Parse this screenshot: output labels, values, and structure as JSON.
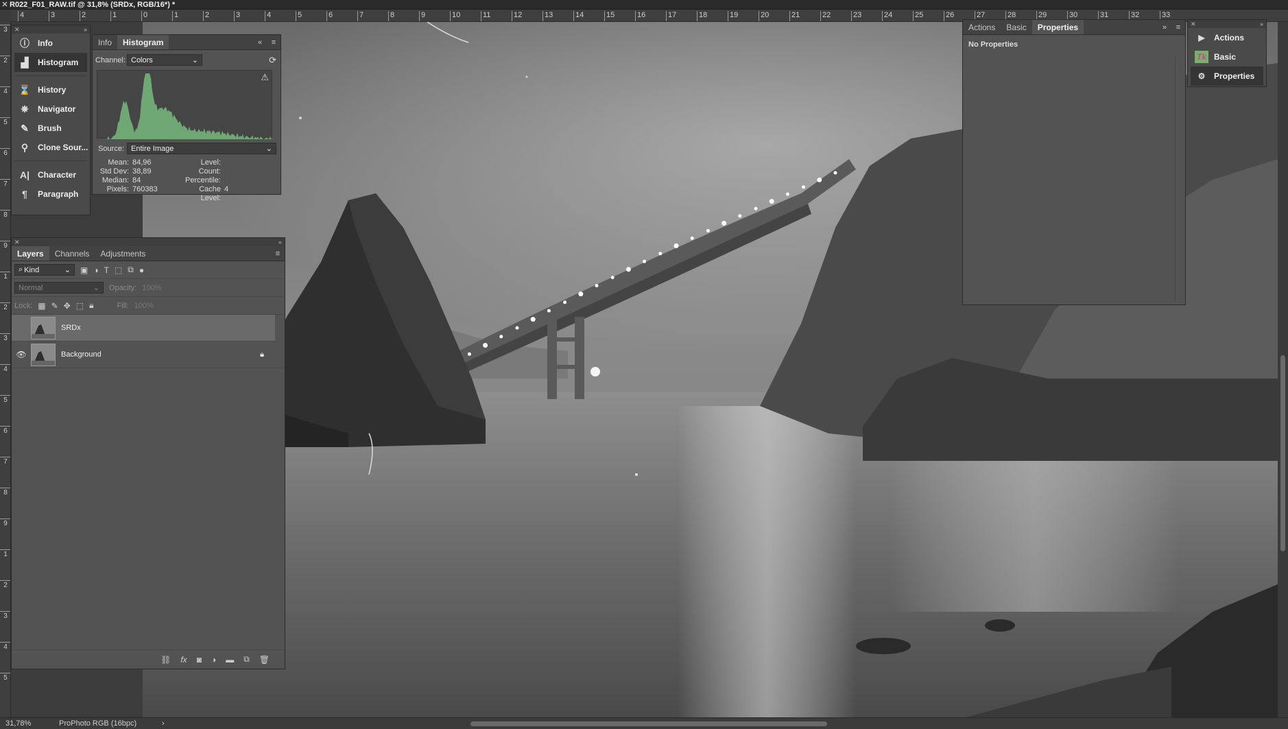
{
  "window": {
    "title": "R022_F01_RAW.tif @ 31,8% (SRDx, RGB/16*) *"
  },
  "ruler_top": [
    "4",
    "3",
    "2",
    "1",
    "0",
    "1",
    "2",
    "3",
    "4",
    "5",
    "6",
    "7",
    "8",
    "9",
    "10",
    "11",
    "12",
    "13",
    "14",
    "15",
    "16",
    "17",
    "18",
    "19",
    "20",
    "21",
    "22",
    "23",
    "24",
    "25",
    "26",
    "27",
    "28",
    "29",
    "30",
    "31",
    "32",
    "33"
  ],
  "ruler_left": [
    "3",
    "2",
    "4",
    "5",
    "6",
    "7",
    "8",
    "9",
    "1",
    "2",
    "3",
    "4",
    "5",
    "6",
    "7",
    "8",
    "9",
    "1",
    "2",
    "3",
    "4",
    "5"
  ],
  "left_dock": {
    "items": [
      {
        "label": "Info",
        "icon": "info-icon"
      },
      {
        "label": "Histogram",
        "icon": "histogram-icon"
      },
      {
        "label": "History",
        "icon": "history-icon"
      },
      {
        "label": "Navigator",
        "icon": "navigator-icon"
      },
      {
        "label": "Brush",
        "icon": "brush-icon"
      },
      {
        "label": "Clone Sour...",
        "icon": "clone-source-icon"
      },
      {
        "label": "Character",
        "icon": "character-icon"
      },
      {
        "label": "Paragraph",
        "icon": "paragraph-icon"
      }
    ]
  },
  "histogram": {
    "tabs": [
      "Info",
      "Histogram"
    ],
    "channel_label": "Channel:",
    "channel_value": "Colors",
    "source_label": "Source:",
    "source_value": "Entire Image",
    "stats_left": [
      {
        "k": "Mean:",
        "v": "84,96"
      },
      {
        "k": "Std Dev:",
        "v": "38,89"
      },
      {
        "k": "Median:",
        "v": "84"
      },
      {
        "k": "Pixels:",
        "v": "760383"
      }
    ],
    "stats_right": [
      {
        "k": "Level:",
        "v": ""
      },
      {
        "k": "Count:",
        "v": ""
      },
      {
        "k": "Percentile:",
        "v": ""
      },
      {
        "k": "Cache Level:",
        "v": "4"
      }
    ],
    "graph_color": "#6fa875"
  },
  "layers": {
    "tabs": [
      "Layers",
      "Channels",
      "Adjustments"
    ],
    "kind_label": "Kind",
    "blend_mode": "Normal",
    "opacity_label": "Opacity:",
    "opacity_value": "100%",
    "lock_label": "Lock:",
    "fill_label": "Fill:",
    "fill_value": "100%",
    "rows": [
      {
        "name": "SRDx",
        "visible": false,
        "locked": false,
        "selected": true
      },
      {
        "name": "Background",
        "visible": true,
        "locked": true,
        "selected": false
      }
    ]
  },
  "properties": {
    "tabs": [
      "Actions",
      "Basic",
      "Properties"
    ],
    "body": "No Properties"
  },
  "right_dock": {
    "items": [
      {
        "label": "Actions",
        "icon": "play-icon"
      },
      {
        "label": "Basic",
        "icon": "basic-plugin-icon"
      },
      {
        "label": "Properties",
        "icon": "properties-icon"
      }
    ]
  },
  "status": {
    "zoom": "31,78%",
    "profile": "ProPhoto RGB (16bpc)"
  }
}
